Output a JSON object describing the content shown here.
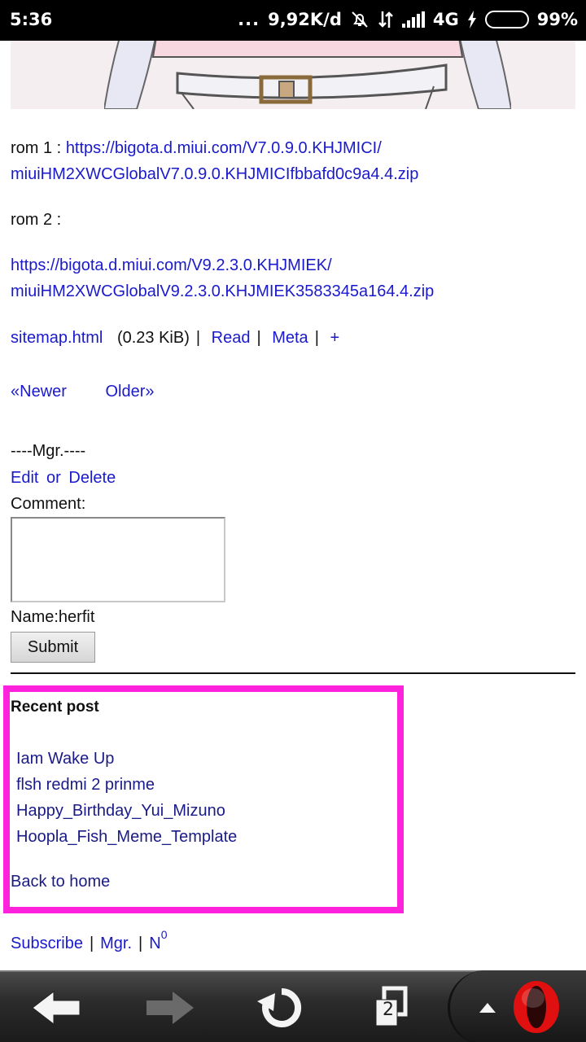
{
  "status_bar": {
    "time": "5:36",
    "dots": "...",
    "net_speed": "9,92K/d",
    "network": "4G",
    "battery_pct": "99%",
    "battery_level": 0.99
  },
  "post": {
    "rom1_label": "rom 1 :",
    "rom1_link_line1": "https://bigota.d.miui.com/V7.0.9.0.KHJMICI/",
    "rom1_link_line2": "miuiHM2XWCGlobalV7.0.9.0.KHJMICIfbbafd0c9a4.4.zip",
    "rom2_label": "rom 2 :",
    "rom2_link_line1": "https://bigota.d.miui.com/V9.2.3.0.KHJMIEK/",
    "rom2_link_line2": "miuiHM2XWCGlobalV9.2.3.0.KHJMIEK3583345a164.4.zip"
  },
  "file_meta": {
    "filename": "sitemap.html",
    "size": "(0.23 KiB)",
    "read": "Read",
    "meta": "Meta",
    "plus": "+"
  },
  "pager": {
    "newer": "«Newer",
    "older": "Older»"
  },
  "manage": {
    "mgr_label": "----Mgr.----",
    "edit": "Edit",
    "or": "or",
    "delete": "Delete",
    "comment_label": "Comment:",
    "comment_value": "",
    "name_label": "Name:herfit",
    "submit": "Submit"
  },
  "recent": {
    "title": "Recent post",
    "items": [
      "Iam Wake Up",
      "flsh redmi 2 prinme",
      "Happy_Birthday_Yui_Mizuno",
      "Hoopla_Fish_Meme_Template"
    ],
    "back": "Back to home"
  },
  "footer": {
    "subscribe": "Subscribe",
    "mgr": "Mgr.",
    "n": "N",
    "n_sup": "0"
  },
  "navbar": {
    "tab_count": "2"
  },
  "colors": {
    "link": "#1a1acc",
    "recent_border": "#ff22dd",
    "battery": "#2ee02e",
    "opera_red": "#e01010"
  }
}
